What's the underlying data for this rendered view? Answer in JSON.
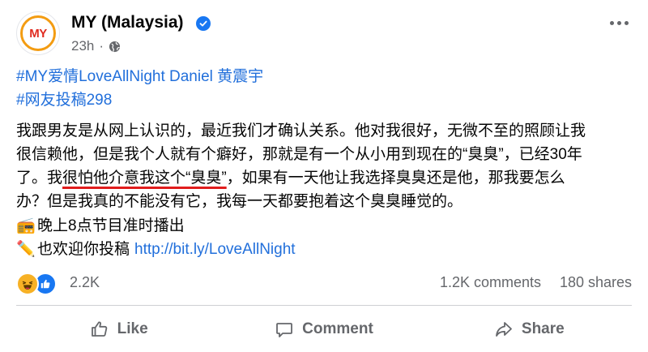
{
  "post": {
    "page_name": "MY (Malaysia)",
    "avatar_text": "MY",
    "timestamp": "23h",
    "audience_icon": "globe-icon",
    "menu_icon": "more-horizontal-icon"
  },
  "content": {
    "hashtags": [
      "#MY爱情LoveAllNight Daniel 黄震宇",
      "#网友投稿298"
    ],
    "body": {
      "line1": "我跟男友是从网上认识的，最近我们才确认关系。他对我很好，无微不至的照顾让我",
      "line2": "很信赖他，但是我个人就有个癖好，那就是有一个从小用到现在的“臭臭”，已经30年",
      "line3_pre": "了。我",
      "line3_underlined": "很怕他介意我这个“臭臭”",
      "line3_post": "，如果有一天他让我选择臭臭还是他，那我要怎么",
      "line4": "办？但是我真的不能没有它，我每一天都要抱着这个臭臭睡觉的。"
    },
    "extra": {
      "broadcast_emoji": "📻",
      "broadcast_text": "晚上8点节目准时播出",
      "pencil_emoji": "✏️",
      "submit_text": "也欢迎你投稿",
      "link": "http://bit.ly/LoveAllNight"
    }
  },
  "stats": {
    "reactions_count": "2.2K",
    "comments": "1.2K comments",
    "shares": "180 shares"
  },
  "actions": {
    "like": "Like",
    "comment": "Comment",
    "share": "Share"
  },
  "colors": {
    "accent": "#1877f2",
    "link": "#216fdb",
    "muted": "#65676b",
    "underline": "#e11d1d"
  }
}
